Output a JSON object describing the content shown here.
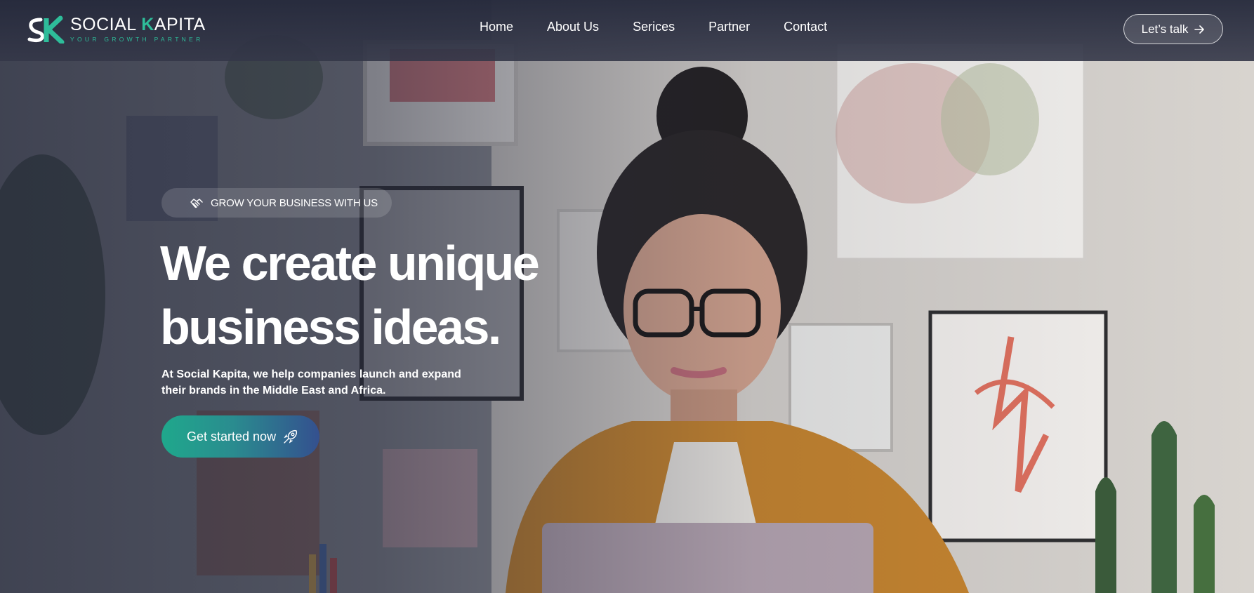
{
  "brand": {
    "name_part1": "SOCIAL ",
    "name_part2": "K",
    "name_part3": "APITA",
    "tagline": "YOUR GROWTH PARTNER",
    "accent_color": "#2ebd9a"
  },
  "nav": {
    "items": [
      {
        "label": "Home"
      },
      {
        "label": "About Us"
      },
      {
        "label": "Serices"
      },
      {
        "label": "Partner"
      },
      {
        "label": "Contact"
      }
    ],
    "cta_label": "Let’s talk",
    "cta_icon": "arrow-right-icon"
  },
  "hero": {
    "badge_icon": "handshake-icon",
    "badge_text": "GROW YOUR BUSINESS WITH US",
    "headline_line1": "We create unique",
    "headline_line2": "business ideas.",
    "subtext": "At Social Kapita, we help companies launch and expand their brands in the Middle East and Africa.",
    "cta_label": "Get started now",
    "cta_icon": "rocket-icon",
    "cta_gradient": [
      "#1fa88c",
      "#34508f"
    ]
  }
}
